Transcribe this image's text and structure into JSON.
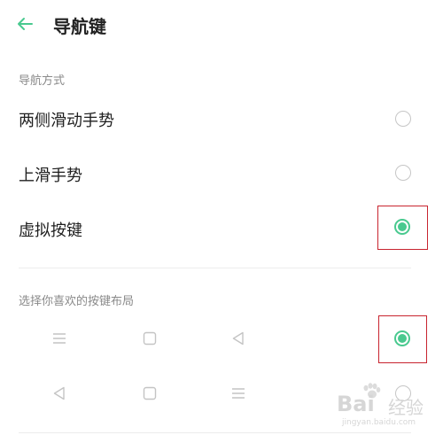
{
  "header": {
    "title": "导航键",
    "back_icon": "arrow-left-icon"
  },
  "nav_method": {
    "section_title": "导航方式",
    "options": [
      {
        "label": "两侧滑动手势",
        "selected": false
      },
      {
        "label": "上滑手势",
        "selected": false
      },
      {
        "label": "虚拟按键",
        "selected": true
      }
    ]
  },
  "layout": {
    "section_title": "选择你喜欢的按键布局",
    "rows": [
      {
        "icons": [
          "menu-icon",
          "home-square-icon",
          "back-triangle-icon"
        ],
        "selected": true
      },
      {
        "icons": [
          "back-triangle-icon",
          "home-square-icon",
          "menu-icon"
        ],
        "selected": false
      }
    ]
  },
  "watermark": {
    "logo": "Bai",
    "suffix": "经验",
    "url": "jingyan.baidu.com"
  },
  "colors": {
    "accent": "#49c98f",
    "highlight": "#c8242f",
    "muted_text": "#8a8a8a",
    "icon_gray": "#c4c4c4"
  }
}
